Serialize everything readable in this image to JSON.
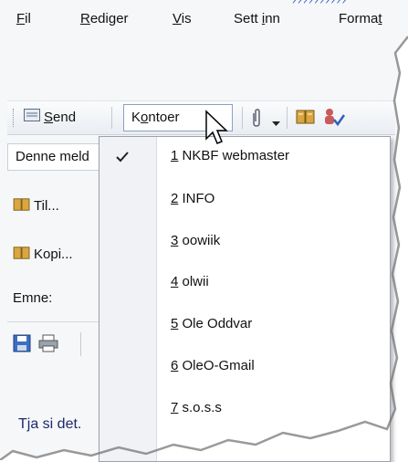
{
  "menubar": {
    "items": [
      {
        "label": "Fil",
        "mnemonic": "F",
        "rest": "il"
      },
      {
        "label": "Rediger",
        "mnemonic": "R",
        "rest": "ediger"
      },
      {
        "label": "Vis",
        "mnemonic": "V",
        "rest": "is"
      },
      {
        "label": "Sett inn",
        "pre": "Sett ",
        "mnemonic": "i",
        "rest": "nn"
      },
      {
        "label": "Format",
        "pre": "Forma",
        "mnemonic": "t",
        "rest": ""
      }
    ]
  },
  "toolbar": {
    "send_label": "Send",
    "send_mnemonic": "S",
    "send_rest": "end",
    "kontoer_label": "Kontoer",
    "kontoer_pre": "K",
    "kontoer_mnemonic": "o",
    "kontoer_rest": "ntoer"
  },
  "form": {
    "account_field": "Denne meld",
    "to_label": "Til...",
    "cc_label": "Kopi...",
    "subject_label": "Emne:"
  },
  "body_text": "Tja si det.",
  "account_menu": {
    "items": [
      {
        "num": "1",
        "label": " NKBF webmaster",
        "checked": true
      },
      {
        "num": "2",
        "label": " INFO",
        "checked": false
      },
      {
        "num": "3",
        "label": " oowiik",
        "checked": false
      },
      {
        "num": "4",
        "label": " olwii",
        "checked": false
      },
      {
        "num": "5",
        "label": " Ole Oddvar",
        "checked": false
      },
      {
        "num": "6",
        "label": " OleO-Gmail",
        "checked": false
      },
      {
        "num": "7",
        "label": " s.o.s.s",
        "checked": false
      }
    ]
  },
  "colors": {
    "check_gutter": "#f0f2f5",
    "menu_border": "#9aa2ad",
    "highlight_blue": "#2a56c6"
  },
  "icons": {
    "send": "envelope-send-icon",
    "attach": "paperclip-icon",
    "address_book": "address-book-icon",
    "check_names": "check-names-icon",
    "save": "save-disk-icon",
    "print": "printer-icon",
    "cursor": "mouse-pointer-icon"
  }
}
